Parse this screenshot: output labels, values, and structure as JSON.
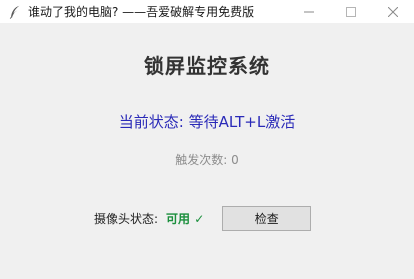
{
  "window": {
    "title": "谁动了我的电脑? ——吾爱破解专用免费版",
    "icon": "feather-icon",
    "controls": [
      "minimize-icon",
      "maximize-icon",
      "close-icon"
    ]
  },
  "main": {
    "heading": "锁屏监控系统",
    "status": "当前状态: 等待ALT+L激活",
    "counter": "触发次数: 0",
    "camera": {
      "label": "摄像头状态:",
      "value": "可用 ✓",
      "check_button": "检查"
    }
  },
  "colors": {
    "status": "#2a2ab8",
    "camera_ok": "#1a8f3c",
    "counter": "#8c8c8c"
  }
}
